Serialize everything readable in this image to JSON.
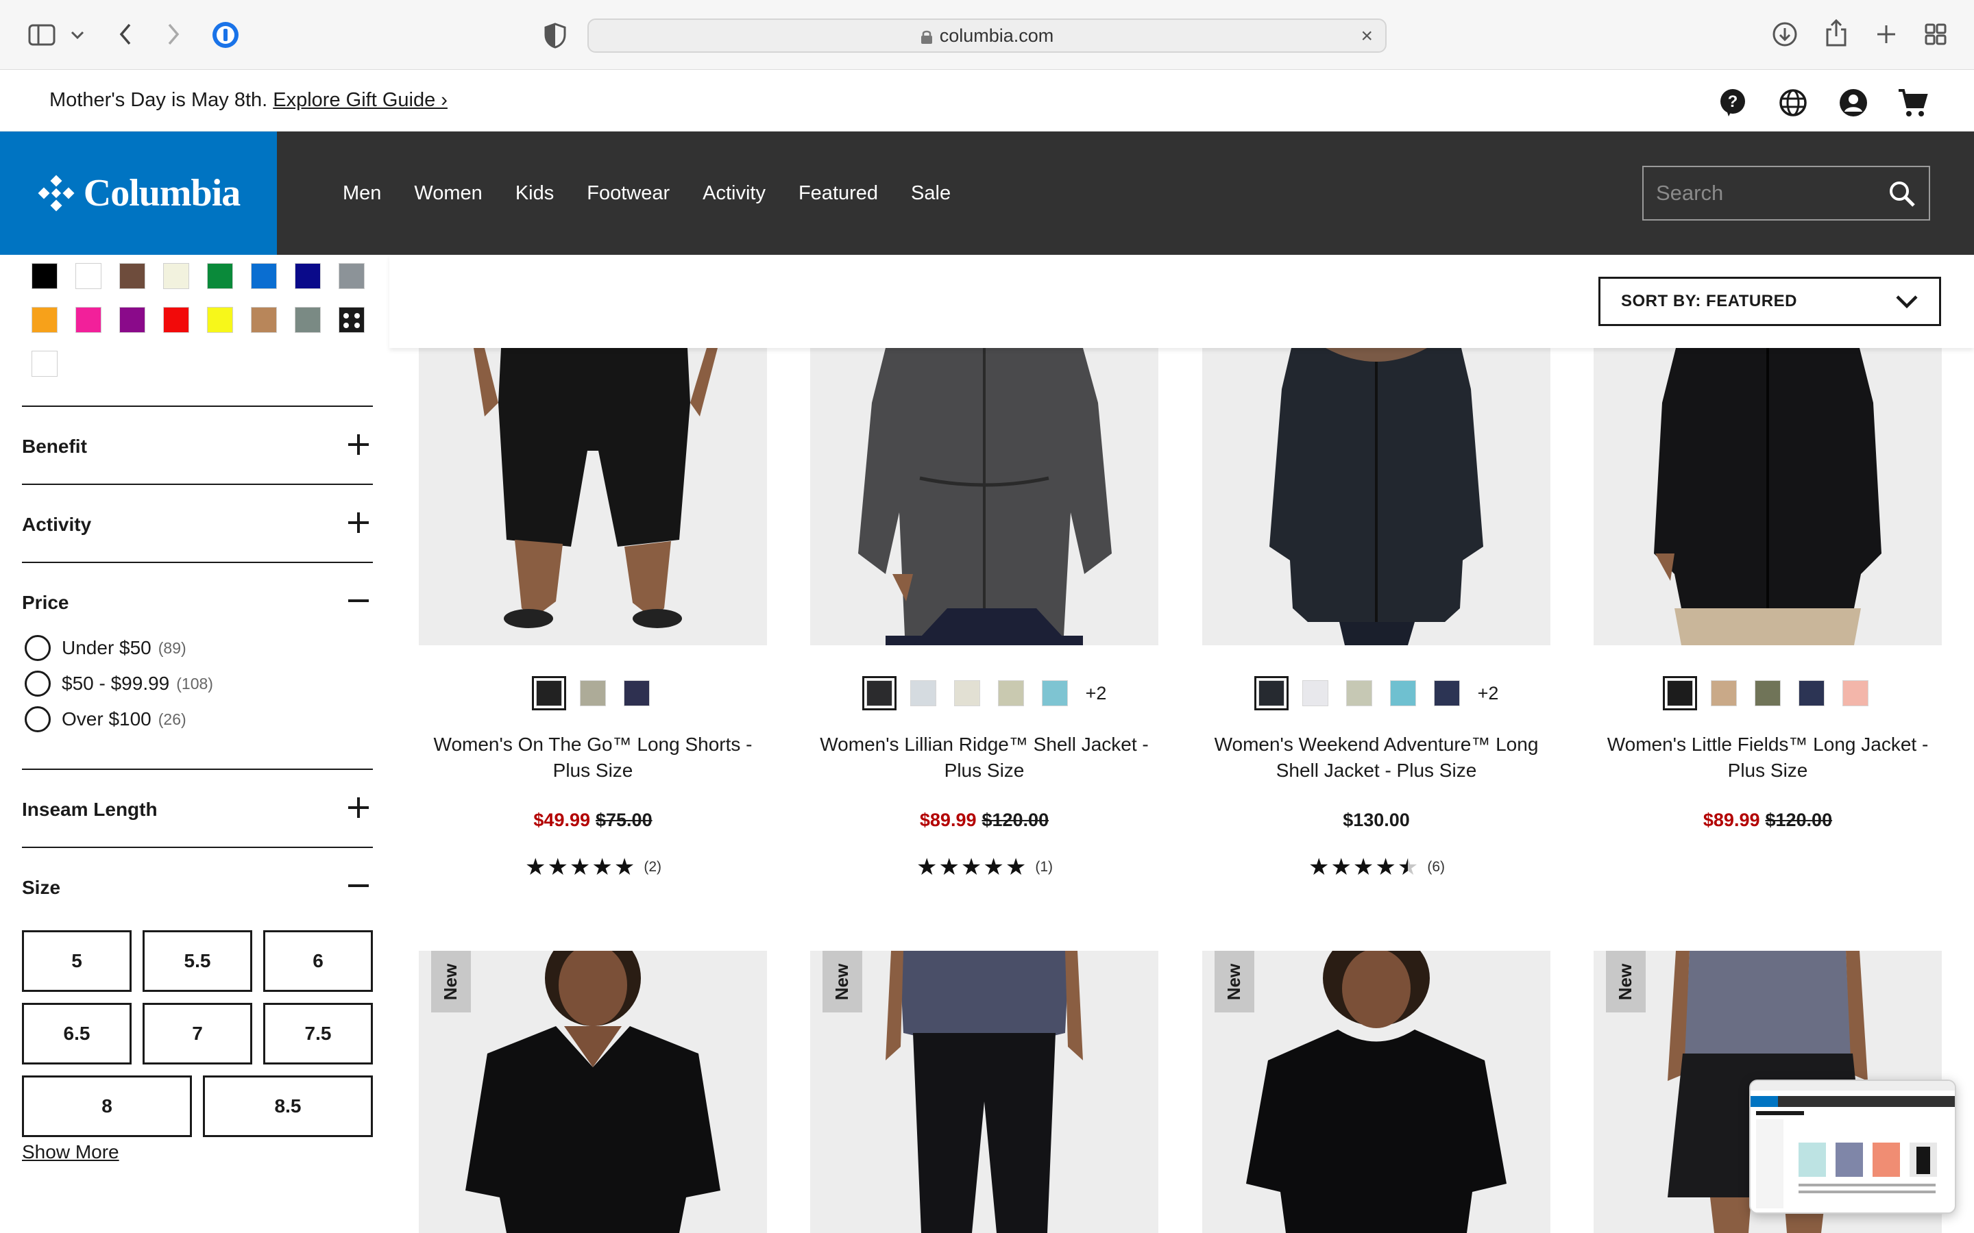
{
  "browser": {
    "url": "columbia.com"
  },
  "promo": {
    "text": "Mother's Day is May 8th.",
    "link": "Explore Gift Guide ›"
  },
  "brand": {
    "name": "Columbia",
    "color": "#0074c2"
  },
  "nav": {
    "items": [
      "Men",
      "Women",
      "Kids",
      "Footwear",
      "Activity",
      "Featured",
      "Sale"
    ]
  },
  "search": {
    "placeholder": "Search"
  },
  "sort": {
    "label": "SORT BY: FEATURED"
  },
  "filters": {
    "colors": [
      "#000000",
      "#ffffff",
      "#6e4c3c",
      "#f2f2de",
      "#0a8a3a",
      "#0a6ed1",
      "#0a0a8a",
      "#8c9398",
      "#f7a11a",
      "#f2209a",
      "#8a0a8a",
      "#f20a0a",
      "#f7f71a",
      "#b8865a",
      "#7a8a84",
      "#1a1a1a",
      "#ffffff"
    ],
    "benefit": "Benefit",
    "activity": "Activity",
    "price": {
      "title": "Price",
      "options": [
        {
          "label": "Under $50",
          "count": "(89)"
        },
        {
          "label": "$50 - $99.99",
          "count": "(108)"
        },
        {
          "label": "Over $100",
          "count": "(26)"
        }
      ]
    },
    "inseam": "Inseam Length",
    "size": {
      "title": "Size",
      "options": [
        "5",
        "5.5",
        "6",
        "6.5",
        "7",
        "7.5",
        "8",
        "8.5"
      ],
      "show_more": "Show More"
    }
  },
  "products": [
    {
      "name": "Women's On The Go™ Long Shorts - Plus Size",
      "sale_price": "$49.99",
      "original_price": "$75.00",
      "rating": 5,
      "rating_count": "(2)",
      "swatches": [
        "#222222",
        "#adab98",
        "#2e3050"
      ],
      "more": ""
    },
    {
      "name": "Women's Lillian Ridge™ Shell Jacket - Plus Size",
      "sale_price": "$89.99",
      "original_price": "$120.00",
      "rating": 5,
      "rating_count": "(1)",
      "swatches": [
        "#2b2b2d",
        "#d5dbe0",
        "#e2e0d3",
        "#c9c9b0",
        "#7ec4d2"
      ],
      "more": "+2"
    },
    {
      "name": "Women's Weekend Adventure™ Long Shell Jacket - Plus Size",
      "price": "$130.00",
      "rating": 4.5,
      "rating_count": "(6)",
      "swatches": [
        "#262a30",
        "#e8e8ec",
        "#c6c8b4",
        "#6fc0d0",
        "#2c3454"
      ],
      "more": "+2"
    },
    {
      "name": "Women's Little Fields™ Long Jacket - Plus Size",
      "sale_price": "$89.99",
      "original_price": "$120.00",
      "rating": 0,
      "rating_count": "",
      "swatches": [
        "#1c1c1c",
        "#c9a988",
        "#707458",
        "#2c3454",
        "#f3b6aa"
      ],
      "more": ""
    }
  ],
  "second_row": {
    "badge": "New"
  }
}
